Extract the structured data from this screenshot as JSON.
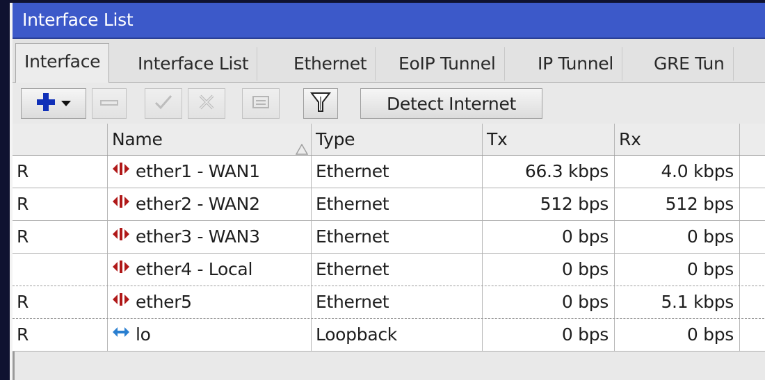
{
  "window": {
    "title": "Interface List"
  },
  "tabs": [
    {
      "label": "Interface"
    },
    {
      "label": "Interface List"
    },
    {
      "label": "Ethernet"
    },
    {
      "label": "EoIP Tunnel"
    },
    {
      "label": "IP Tunnel"
    },
    {
      "label": "GRE Tun"
    }
  ],
  "toolbar": {
    "detect_label": "Detect Internet"
  },
  "columns": {
    "flags": "",
    "name": "Name",
    "type": "Type",
    "tx": "Tx",
    "rx": "Rx"
  },
  "rows": [
    {
      "flag": "R",
      "name": "ether1 - WAN1",
      "type": "Ethernet",
      "tx": "66.3 kbps",
      "rx": "4.0 kbps",
      "icon": "ethernet-icon"
    },
    {
      "flag": "R",
      "name": "ether2 - WAN2",
      "type": "Ethernet",
      "tx": "512 bps",
      "rx": "512 bps",
      "icon": "ethernet-icon"
    },
    {
      "flag": "R",
      "name": "ether3 - WAN3",
      "type": "Ethernet",
      "tx": "0 bps",
      "rx": "0 bps",
      "icon": "ethernet-icon"
    },
    {
      "flag": "",
      "name": "ether4 - Local",
      "type": "Ethernet",
      "tx": "0 bps",
      "rx": "0 bps",
      "icon": "ethernet-icon"
    },
    {
      "flag": "R",
      "name": "ether5",
      "type": "Ethernet",
      "tx": "0 bps",
      "rx": "5.1 kbps",
      "icon": "ethernet-icon"
    },
    {
      "flag": "R",
      "name": "lo",
      "type": "Loopback",
      "tx": "0 bps",
      "rx": "0 bps",
      "icon": "loopback-icon"
    }
  ],
  "colors": {
    "title_bar": "#3c59c9",
    "add_icon": "#1030b8",
    "ethernet_icon": "#b01818",
    "loopback_icon": "#2a7fd0"
  }
}
